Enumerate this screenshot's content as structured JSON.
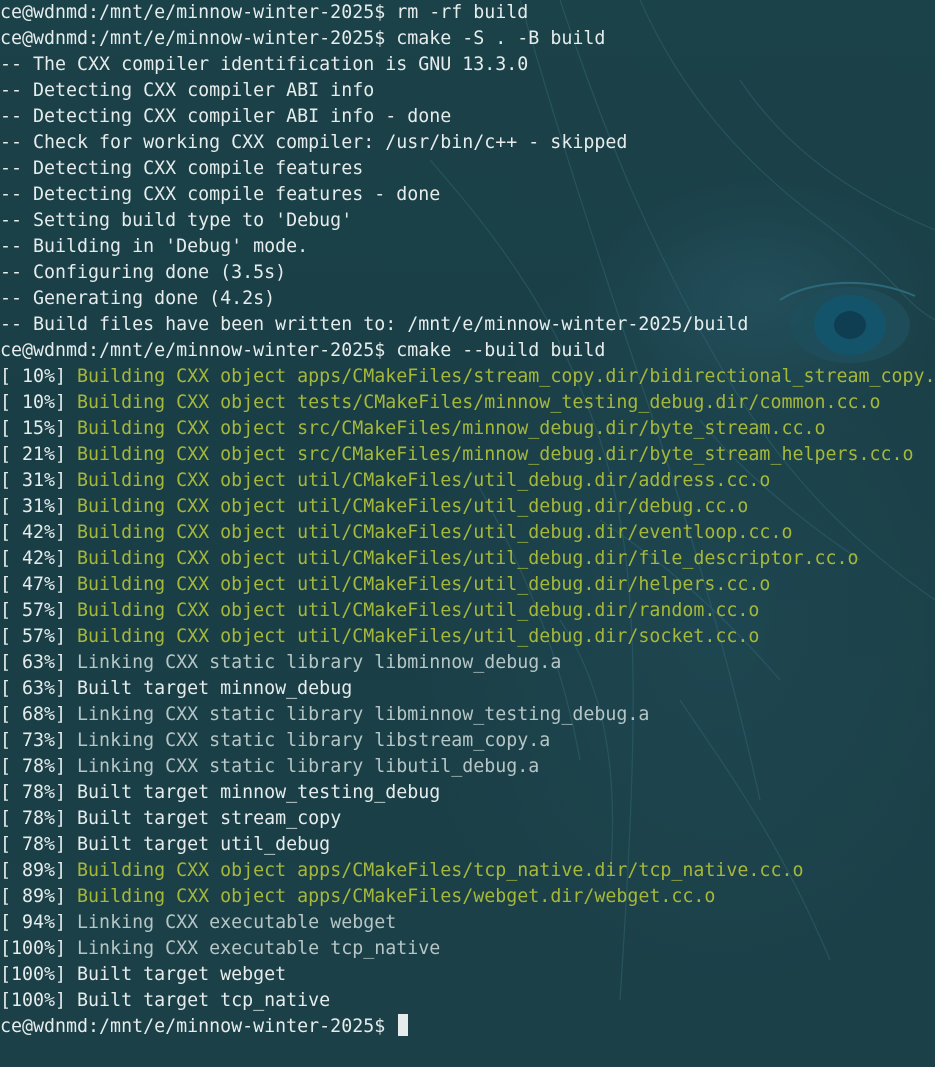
{
  "terminal": {
    "colors": {
      "background": "#1a3f47",
      "text": "#e6ecec",
      "building": "#a6b83a",
      "linking": "#b6c6c6"
    },
    "lines": [
      {
        "prompt": "ce@wdnmd:/mnt/e/minnow-winter-2025$ ",
        "text": "rm -rf build"
      },
      {
        "prompt": "ce@wdnmd:/mnt/e/minnow-winter-2025$ ",
        "text": "cmake -S . -B build"
      },
      {
        "prefix": "",
        "text": "-- The CXX compiler identification is GNU 13.3.0"
      },
      {
        "prefix": "",
        "text": "-- Detecting CXX compiler ABI info"
      },
      {
        "prefix": "",
        "text": "-- Detecting CXX compiler ABI info - done"
      },
      {
        "prefix": "",
        "text": "-- Check for working CXX compiler: /usr/bin/c++ - skipped"
      },
      {
        "prefix": "",
        "text": "-- Detecting CXX compile features"
      },
      {
        "prefix": "",
        "text": "-- Detecting CXX compile features - done"
      },
      {
        "prefix": "",
        "text": "-- Setting build type to 'Debug'"
      },
      {
        "prefix": "",
        "text": "-- Building in 'Debug' mode."
      },
      {
        "prefix": "",
        "text": "-- Configuring done (3.5s)"
      },
      {
        "prefix": "",
        "text": "-- Generating done (4.2s)"
      },
      {
        "prefix": "",
        "text": "-- Build files have been written to: /mnt/e/minnow-winter-2025/build"
      },
      {
        "prompt": "ce@wdnmd:/mnt/e/minnow-winter-2025$ ",
        "text": "cmake --build build"
      },
      {
        "prefix": "[ 10%] ",
        "text": "Building CXX object apps/CMakeFiles/stream_copy.dir/bidirectional_stream_copy.cc.o"
      },
      {
        "prefix": "[ 10%] ",
        "text": "Building CXX object tests/CMakeFiles/minnow_testing_debug.dir/common.cc.o"
      },
      {
        "prefix": "[ 15%] ",
        "text": "Building CXX object src/CMakeFiles/minnow_debug.dir/byte_stream.cc.o"
      },
      {
        "prefix": "[ 21%] ",
        "text": "Building CXX object src/CMakeFiles/minnow_debug.dir/byte_stream_helpers.cc.o"
      },
      {
        "prefix": "[ 31%] ",
        "text": "Building CXX object util/CMakeFiles/util_debug.dir/address.cc.o"
      },
      {
        "prefix": "[ 31%] ",
        "text": "Building CXX object util/CMakeFiles/util_debug.dir/debug.cc.o"
      },
      {
        "prefix": "[ 42%] ",
        "text": "Building CXX object util/CMakeFiles/util_debug.dir/eventloop.cc.o"
      },
      {
        "prefix": "[ 42%] ",
        "text": "Building CXX object util/CMakeFiles/util_debug.dir/file_descriptor.cc.o"
      },
      {
        "prefix": "[ 47%] ",
        "text": "Building CXX object util/CMakeFiles/util_debug.dir/helpers.cc.o"
      },
      {
        "prefix": "[ 57%] ",
        "text": "Building CXX object util/CMakeFiles/util_debug.dir/random.cc.o"
      },
      {
        "prefix": "[ 57%] ",
        "text": "Building CXX object util/CMakeFiles/util_debug.dir/socket.cc.o"
      },
      {
        "prefix": "[ 63%] ",
        "text": "Linking CXX static library libminnow_debug.a"
      },
      {
        "prefix": "[ 63%] ",
        "text": "Built target minnow_debug"
      },
      {
        "prefix": "[ 68%] ",
        "text": "Linking CXX static library libminnow_testing_debug.a"
      },
      {
        "prefix": "[ 73%] ",
        "text": "Linking CXX static library libstream_copy.a"
      },
      {
        "prefix": "[ 78%] ",
        "text": "Linking CXX static library libutil_debug.a"
      },
      {
        "prefix": "[ 78%] ",
        "text": "Built target minnow_testing_debug"
      },
      {
        "prefix": "[ 78%] ",
        "text": "Built target stream_copy"
      },
      {
        "prefix": "[ 78%] ",
        "text": "Built target util_debug"
      },
      {
        "prefix": "[ 89%] ",
        "text": "Building CXX object apps/CMakeFiles/tcp_native.dir/tcp_native.cc.o"
      },
      {
        "prefix": "[ 89%] ",
        "text": "Building CXX object apps/CMakeFiles/webget.dir/webget.cc.o"
      },
      {
        "prefix": "[ 94%] ",
        "text": "Linking CXX executable webget"
      },
      {
        "prefix": "[100%] ",
        "text": "Linking CXX executable tcp_native"
      },
      {
        "prefix": "[100%] ",
        "text": "Built target webget"
      },
      {
        "prefix": "[100%] ",
        "text": "Built target tcp_native"
      },
      {
        "prompt": "ce@wdnmd:/mnt/e/minnow-winter-2025$ ",
        "text": ""
      }
    ]
  }
}
